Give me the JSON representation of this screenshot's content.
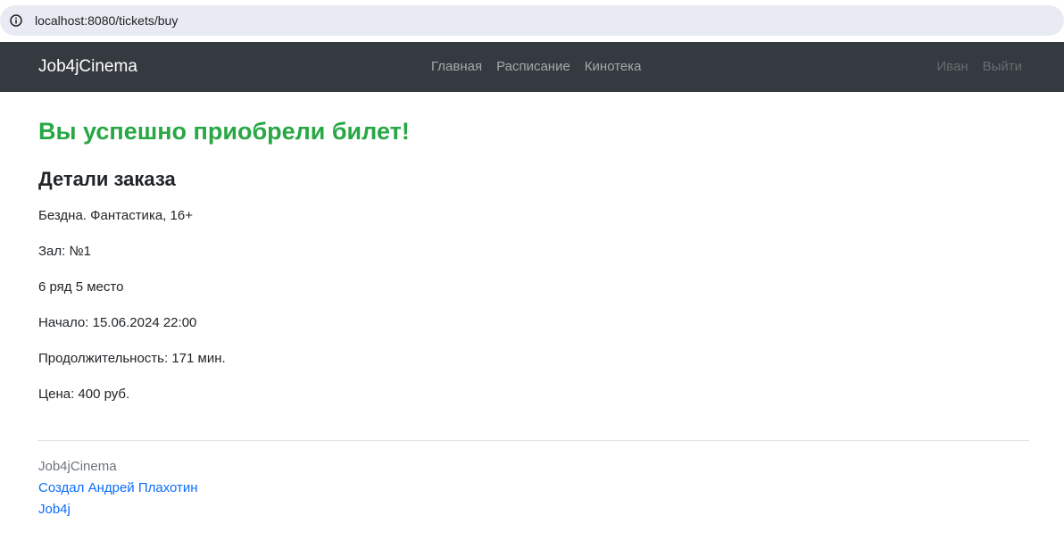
{
  "browser": {
    "url": "localhost:8080/tickets/buy",
    "info_icon": "info-circle-icon"
  },
  "navbar": {
    "brand": "Job4jCinema",
    "links": [
      "Главная",
      "Расписание",
      "Кинотека"
    ],
    "user": "Иван",
    "logout": "Выйти"
  },
  "main": {
    "success_title": "Вы успешно приобрели билет!",
    "details_title": "Детали заказа",
    "details": [
      "Бездна. Фантастика, 16+",
      "Зал: №1",
      "6 ряд 5 место",
      "Начало: 15.06.2024 22:00",
      "Продолжительность: 171 мин.",
      "Цена: 400 руб."
    ]
  },
  "footer": {
    "brand": "Job4jCinema",
    "author_link": "Создал Андрей Плахотин",
    "job4j_link": "Job4j"
  },
  "colors": {
    "navbar_bg": "#343a40",
    "success": "#28a745",
    "link": "#0d6efd",
    "address_bar_bg": "#e9ebf4"
  }
}
